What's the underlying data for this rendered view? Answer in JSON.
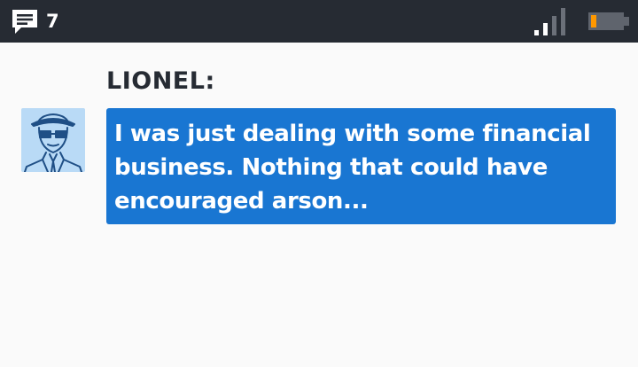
{
  "status_bar": {
    "message_count": "7",
    "icons": {
      "messages": "chat-bubble-lines-icon",
      "signal": "signal-strength-icon",
      "battery": "battery-low-icon"
    },
    "signal_bars_active": 2,
    "signal_bars_total": 4,
    "battery_level": 0.15,
    "colors": {
      "background": "#262b33",
      "battery_fill": "#ff9800",
      "signal_active": "#ffffff",
      "signal_inactive": "#6b7079"
    }
  },
  "dialogue": {
    "speaker": "LIONEL:",
    "avatar": "detective-portrait-icon",
    "text": "I was just dealing with some financial business. Nothing that could have encouraged arson...",
    "colors": {
      "bubble": "#1976d2",
      "text": "#ffffff",
      "speaker": "#262b33",
      "avatar_bg": "#b9daf6"
    }
  }
}
